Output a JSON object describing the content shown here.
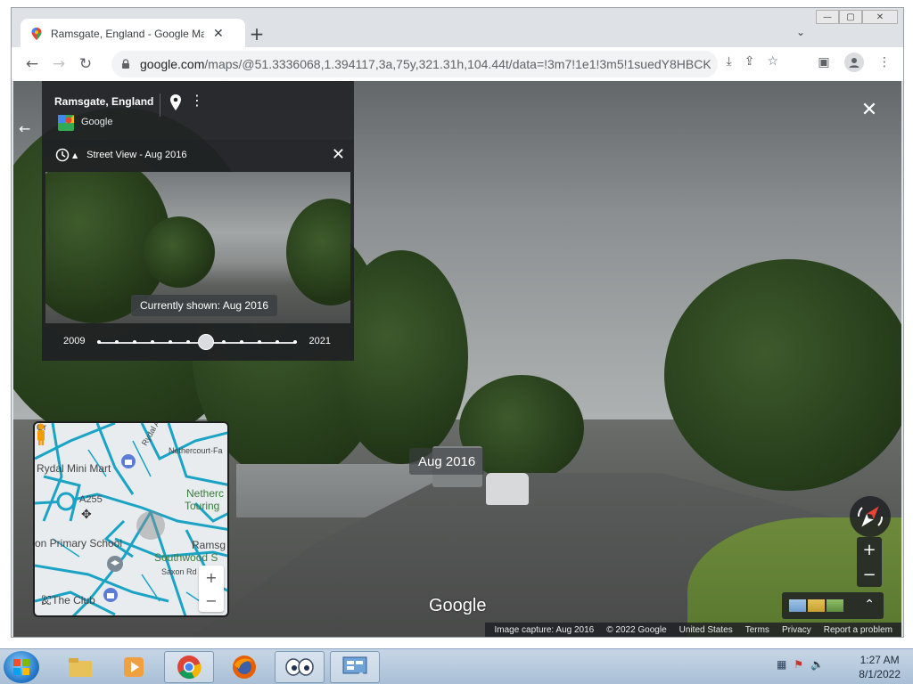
{
  "browser": {
    "tab_title": "Ramsgate, England - Google Maps",
    "tab_close": "✕",
    "new_tab": "+",
    "tab_search": "⌄",
    "url_host": "google.com",
    "url_path": "/maps/@51.3336068,1.394117,3a,75y,321.31h,104.44t/data=!3m7!1e1!3m5!1suedY8HBCKh...",
    "window_buttons": [
      "—",
      "▢",
      "✕"
    ]
  },
  "streetview": {
    "place_title": "Ramsgate, England",
    "place_subtitle": "Google",
    "time_machine_title": "Street View - Aug 2016",
    "currently_shown": "Currently shown: Aug 2016",
    "year_start": "2009",
    "year_end": "2021",
    "date_badge": "Aug 2016",
    "google_logo": "Google",
    "slider_dot_count": 12,
    "slider_selected_index": 6,
    "footer": {
      "capture": "Image capture: Aug 2016",
      "copyright": "© 2022 Google",
      "country": "United States",
      "terms": "Terms",
      "privacy": "Privacy",
      "report": "Report a problem"
    }
  },
  "minimap": {
    "labels": {
      "rydal_mini_mart": "Rydal Mini Mart",
      "rydal_ave": "Rydal Ave",
      "nethercourt": "Nethercourt-Fa",
      "a255": "A255",
      "nethercourt_touring": "Netherc",
      "touring": "Touring",
      "primary_school": "on Primary School",
      "ramsgate": "Ramsg",
      "southwood": "Southwood S",
      "saxon_rd": "Saxon Rd",
      "the_club": "& The Club",
      "grey_label": "Gr"
    },
    "zoom_in": "+",
    "zoom_out": "−"
  },
  "taskbar": {
    "time": "1:27 AM",
    "date": "8/1/2022"
  },
  "colors": {
    "panel": "#202124",
    "road_blue": "#1aa3c4",
    "pin_orange": "#f29b0c"
  }
}
